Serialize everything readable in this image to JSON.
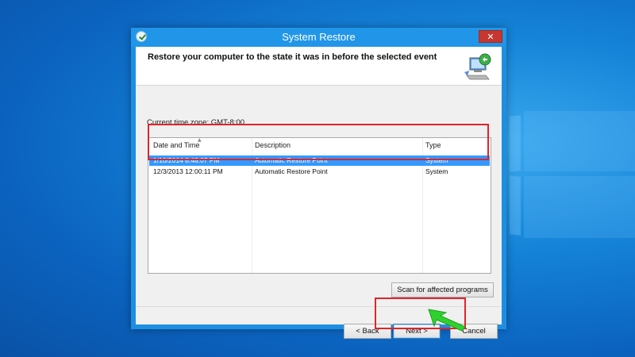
{
  "window": {
    "title": "System Restore",
    "close_label": "✕"
  },
  "header": {
    "text": "Restore your computer to the state it was in before the selected event"
  },
  "timezone": {
    "label": "Current time zone: GMT-8:00"
  },
  "table": {
    "columns": [
      "Date and Time",
      "Description",
      "Type"
    ],
    "rows": [
      {
        "date": "1/10/2014 8:48:07 PM",
        "description": "Automatic Restore Point",
        "type": "System",
        "selected": true
      },
      {
        "date": "12/3/2013 12:00:11 PM",
        "description": "Automatic Restore Point",
        "type": "System",
        "selected": false
      }
    ]
  },
  "buttons": {
    "scan": "Scan for affected programs",
    "back": "< Back",
    "next": "Next >",
    "cancel": "Cancel"
  },
  "colors": {
    "selection": "#3399ff",
    "annotation_red": "#e0242b",
    "annotation_arrow": "#2fd12f"
  }
}
